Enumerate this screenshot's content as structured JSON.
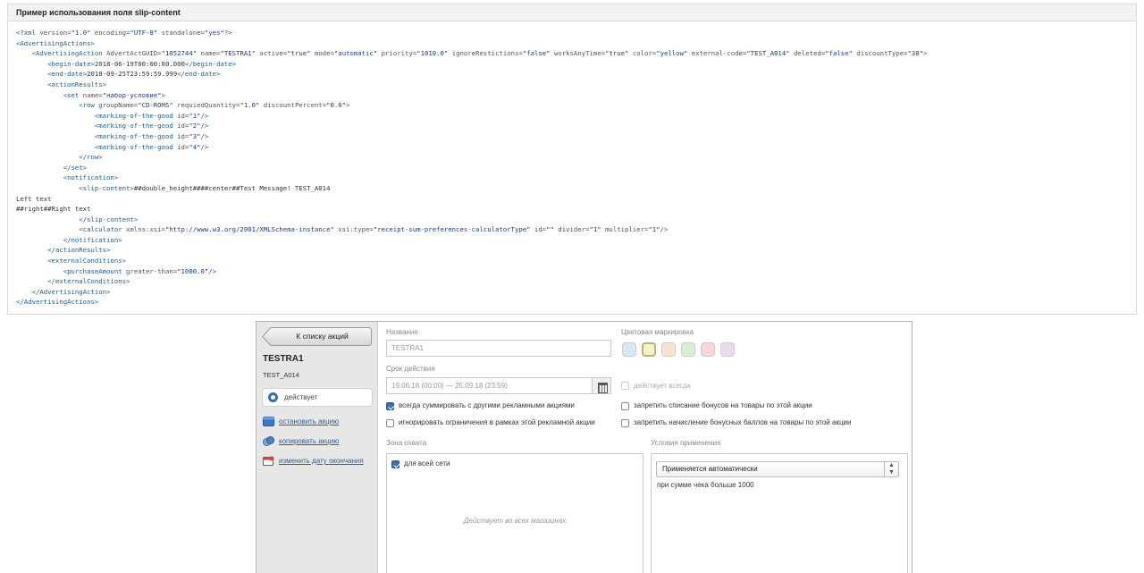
{
  "code_panel": {
    "title": "Пример использования поля slip-content",
    "lines": [
      [
        [
          "t",
          "<?xml "
        ],
        [
          "a",
          "version="
        ],
        [
          "v",
          "\"1.0\""
        ],
        [
          "a",
          " encoding="
        ],
        [
          "v",
          "\"UTF-8\""
        ],
        [
          "a",
          " standalone="
        ],
        [
          "v",
          "\"yes\""
        ],
        [
          "t",
          "?>"
        ]
      ],
      [
        [
          "t",
          "<AdvertisingActions>"
        ]
      ],
      [
        [
          "x",
          "    "
        ],
        [
          "t",
          "<AdvertisingAction "
        ],
        [
          "a",
          "AdvertActGUID="
        ],
        [
          "v",
          "\"1052744\""
        ],
        [
          "a",
          " name="
        ],
        [
          "v",
          "\"TESTRA1\""
        ],
        [
          "a",
          " active="
        ],
        [
          "v",
          "\"true\""
        ],
        [
          "a",
          " mode="
        ],
        [
          "v",
          "\"automatic\""
        ],
        [
          "a",
          " priority="
        ],
        [
          "v",
          "\"1010.0\""
        ],
        [
          "a",
          " ignoreRestictions="
        ],
        [
          "v",
          "\"false\""
        ],
        [
          "a",
          " worksAnyTime="
        ],
        [
          "v",
          "\"true\""
        ],
        [
          "a",
          " color="
        ],
        [
          "v",
          "\"yellow\""
        ],
        [
          "a",
          " external-code="
        ],
        [
          "v",
          "\"TEST_A014\""
        ],
        [
          "a",
          " deleted="
        ],
        [
          "v",
          "\"false\""
        ],
        [
          "a",
          " discountType="
        ],
        [
          "v",
          "\"38\""
        ],
        [
          "t",
          ">"
        ]
      ],
      [
        [
          "x",
          "        "
        ],
        [
          "t",
          "<begin-date>"
        ],
        [
          "x",
          "2018-06-19T00:00:00.000"
        ],
        [
          "t",
          "</begin-date>"
        ]
      ],
      [
        [
          "x",
          "        "
        ],
        [
          "t",
          "<end-date>"
        ],
        [
          "x",
          "2018-09-25T23:59:59.999"
        ],
        [
          "t",
          "</end-date>"
        ]
      ],
      [
        [
          "x",
          "        "
        ],
        [
          "t",
          "<actionResults>"
        ]
      ],
      [
        [
          "x",
          "            "
        ],
        [
          "t",
          "<set "
        ],
        [
          "a",
          "name="
        ],
        [
          "v",
          "\"набор-условие\""
        ],
        [
          "t",
          ">"
        ]
      ],
      [
        [
          "x",
          "                "
        ],
        [
          "t",
          "<row "
        ],
        [
          "a",
          "groupName="
        ],
        [
          "v",
          "\"CD-ROMS\""
        ],
        [
          "a",
          " requiedQuantity="
        ],
        [
          "v",
          "\"1.0\""
        ],
        [
          "a",
          " discountPercent="
        ],
        [
          "v",
          "\"0.0\""
        ],
        [
          "t",
          ">"
        ]
      ],
      [
        [
          "x",
          "                    "
        ],
        [
          "t",
          "<marking-of-the-good "
        ],
        [
          "a",
          "id="
        ],
        [
          "v",
          "\"1\""
        ],
        [
          "t",
          "/>"
        ]
      ],
      [
        [
          "x",
          "                    "
        ],
        [
          "t",
          "<marking-of-the-good "
        ],
        [
          "a",
          "id="
        ],
        [
          "v",
          "\"2\""
        ],
        [
          "t",
          "/>"
        ]
      ],
      [
        [
          "x",
          "                    "
        ],
        [
          "t",
          "<marking-of-the-good "
        ],
        [
          "a",
          "id="
        ],
        [
          "v",
          "\"3\""
        ],
        [
          "t",
          "/>"
        ]
      ],
      [
        [
          "x",
          "                    "
        ],
        [
          "t",
          "<marking-of-the-good "
        ],
        [
          "a",
          "id="
        ],
        [
          "v",
          "\"4\""
        ],
        [
          "t",
          "/>"
        ]
      ],
      [
        [
          "x",
          "                "
        ],
        [
          "t",
          "</row>"
        ]
      ],
      [
        [
          "x",
          "            "
        ],
        [
          "t",
          "</set>"
        ]
      ],
      [
        [
          "x",
          "            "
        ],
        [
          "t",
          "<notification>"
        ]
      ],
      [
        [
          "x",
          "                "
        ],
        [
          "t",
          "<slip-content>"
        ],
        [
          "x",
          "##double_height####center##Test Message! TEST_A014"
        ]
      ],
      [
        [
          "x",
          "Left text"
        ]
      ],
      [
        [
          "x",
          "##right##Right text"
        ]
      ],
      [
        [
          "x",
          "                "
        ],
        [
          "t",
          "</slip-content>"
        ]
      ],
      [
        [
          "x",
          "                "
        ],
        [
          "t",
          "<calculator "
        ],
        [
          "a",
          "xmlns:xsi="
        ],
        [
          "v",
          "\"http://www.w3.org/2001/XMLSchema-instance\""
        ],
        [
          "a",
          " xsi:type="
        ],
        [
          "v",
          "\"receipt-sum-preferences-calculatorType\""
        ],
        [
          "a",
          " id="
        ],
        [
          "v",
          "\"\""
        ],
        [
          "a",
          " divider="
        ],
        [
          "v",
          "\"1\""
        ],
        [
          "a",
          " multiplier="
        ],
        [
          "v",
          "\"1\""
        ],
        [
          "t",
          "/>"
        ]
      ],
      [
        [
          "x",
          "            "
        ],
        [
          "t",
          "</notification>"
        ]
      ],
      [
        [
          "x",
          "        "
        ],
        [
          "t",
          "</actionResults>"
        ]
      ],
      [
        [
          "x",
          "        "
        ],
        [
          "t",
          "<externalConditions>"
        ]
      ],
      [
        [
          "x",
          "            "
        ],
        [
          "t",
          "<purchaseAmount "
        ],
        [
          "a",
          "greater-than="
        ],
        [
          "v",
          "\"1000.0\""
        ],
        [
          "t",
          "/>"
        ]
      ],
      [
        [
          "x",
          "        "
        ],
        [
          "t",
          "</externalConditions>"
        ]
      ],
      [
        [
          "x",
          "    "
        ],
        [
          "t",
          "</AdvertisingAction>"
        ]
      ],
      [
        [
          "t",
          "</AdvertisingActions>"
        ]
      ]
    ]
  },
  "sidebar": {
    "back_label": "К списку акций",
    "promo_name": "TESTRA1",
    "promo_code": "TEST_A014",
    "status": "действует",
    "actions": [
      {
        "label": "остановить акцию",
        "icon": "stop-icon"
      },
      {
        "label": "копировать акцию",
        "icon": "copy-icon"
      },
      {
        "label": "изменить дату окончания",
        "icon": "calendar-icon"
      }
    ]
  },
  "form": {
    "name_label": "Название",
    "name_value": "TESTRA1",
    "color_label": "Цветовая маркировка",
    "colors": [
      "#d6e7f5",
      "#f7f2c6",
      "#f9e2cf",
      "#d8efd2",
      "#f6d6d9",
      "#e8dcf1"
    ],
    "selected_color_index": 1,
    "period_label": "Срок действия",
    "period_value": "19.06.18 (00:00) — 25.09.18 (23:59)",
    "always_active": "действует всегда",
    "checkboxes": {
      "sum_with_others": "всегда суммировать с другими рекламными акциями",
      "ignore_limits": "игнорировать ограничения в рамках этой рекламной акции",
      "forbid_writeoff": "запретить списание бонусов на товары по этой акции",
      "forbid_accrual": "запретить начисление бонусных баллов на товары по этой акции"
    },
    "zone_label": "Зона охвата",
    "zone_all": "для всей сети",
    "zone_empty": "Действует во всех магазинах",
    "conditions_label": "Условия применения",
    "conditions_select": "Применяется автоматически",
    "conditions_text": "при сумме чека больше 1000",
    "calendar_icon": "calendar-icon"
  }
}
